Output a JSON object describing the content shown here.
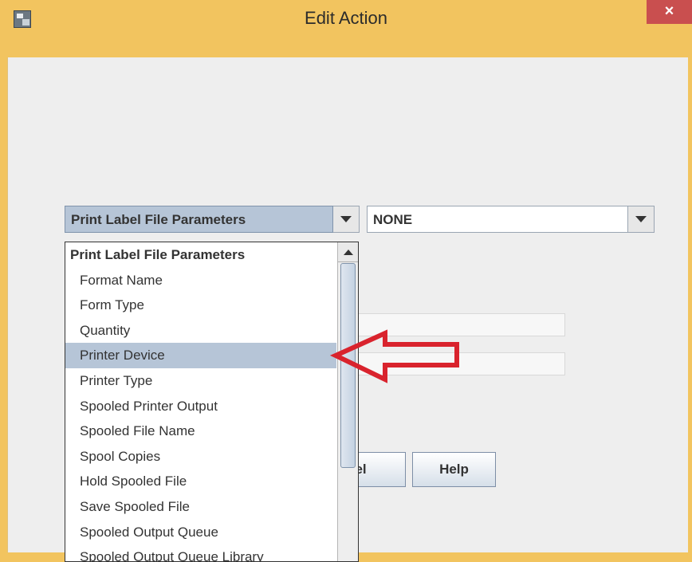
{
  "window": {
    "title": "Edit Action",
    "close_label": "×"
  },
  "param_combo": {
    "selected": "Print Label File Parameters"
  },
  "value_combo": {
    "selected": "NONE"
  },
  "buttons": {
    "cancel_label": "cel",
    "help_label": "Help"
  },
  "dropdown": {
    "header": "Print Label File Parameters",
    "items": [
      "Format Name",
      "Form Type",
      "Quantity",
      "Printer Device",
      "Printer Type",
      "Spooled Printer Output",
      "Spooled File Name",
      "Spool Copies",
      "Hold Spooled File",
      "Save Spooled File",
      "Spooled Output Queue",
      "Spooled Output Queue Library"
    ],
    "selected_item": "Printer Device"
  },
  "colors": {
    "title_bar": "#f2c45f",
    "close": "#c94f4f",
    "selection": "#b6c5d7",
    "annotation_arrow": "#d9232d"
  },
  "icons": [
    "app-icon",
    "close-icon",
    "chevron-down-icon",
    "scroll-up-icon",
    "annotation-arrow-icon"
  ]
}
